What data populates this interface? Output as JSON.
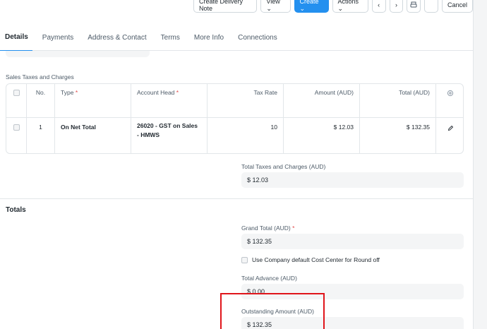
{
  "toolbar": {
    "create_delivery_note": "Create Delivery Note",
    "view": "View ⌄",
    "create": "Create ⌄",
    "actions": "Actions ⌄",
    "prev": "‹",
    "next": "›",
    "cancel": "Cancel"
  },
  "tabs": [
    "Details",
    "Payments",
    "Address & Contact",
    "Terms",
    "More Info",
    "Connections"
  ],
  "taxes": {
    "section_label": "Sales Taxes and Charges",
    "columns": {
      "no": "No.",
      "type": "Type",
      "account_head": "Account Head",
      "tax_rate": "Tax Rate",
      "amount": "Amount (AUD)",
      "total": "Total (AUD)"
    },
    "rows": [
      {
        "no": "1",
        "type": "On Net Total",
        "account_head": "26020 - GST on Sales - HMWS",
        "tax_rate": "10",
        "amount": "$ 12.03",
        "total": "$ 132.35"
      }
    ],
    "total_label": "Total Taxes and Charges (AUD)",
    "total_value": "$ 12.03"
  },
  "totals": {
    "title": "Totals",
    "grand_total_label": "Grand Total (AUD)",
    "grand_total_value": "$ 132.35",
    "round_off_label": "Use Company default Cost Center for Round off",
    "total_advance_label": "Total Advance (AUD)",
    "total_advance_value": "$ 0.00",
    "outstanding_label": "Outstanding Amount (AUD)",
    "outstanding_value": "$ 132.35"
  },
  "colors": {
    "accent": "#2490ef",
    "highlight": "#e0151b",
    "required": "#e24c4c"
  }
}
